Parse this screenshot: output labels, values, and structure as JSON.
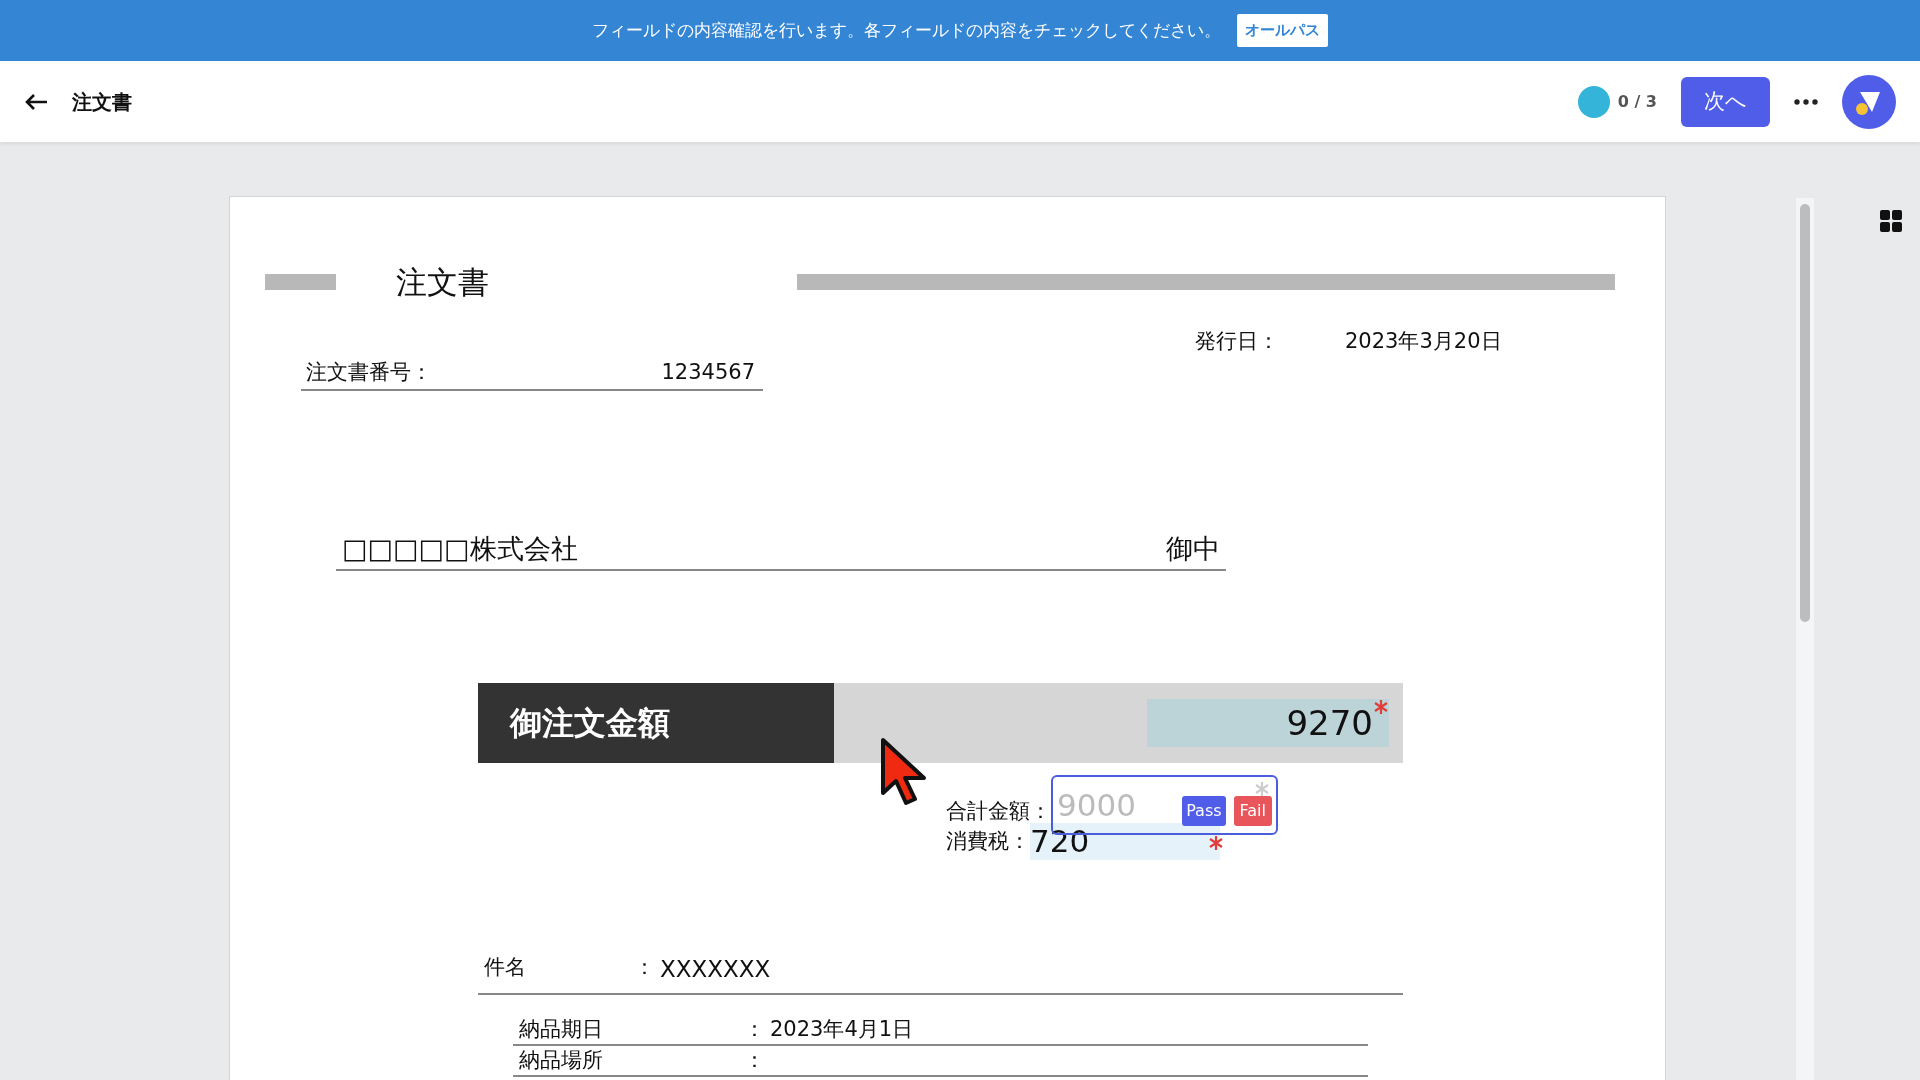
{
  "banner": {
    "message": "フィールドの内容確認を行います。各フィールドの内容をチェックしてください。",
    "button": "オールパス"
  },
  "header": {
    "title": "注文書",
    "progress": "0 / 3",
    "next_button": "次へ"
  },
  "document": {
    "title": "注文書",
    "issue_date_label": "発行日：",
    "issue_date": "2023年3月20日",
    "order_number_label": "注文書番号：",
    "order_number": "1234567",
    "recipient": "□□□□□株式会社",
    "honorific": "御中",
    "amount_label": "御注文金額",
    "amount": "9270",
    "subtotal_label": "合計金額：",
    "subtotal_field": {
      "placeholder": "9000"
    },
    "pass_button": "Pass",
    "fail_button": "Fail",
    "tax_label": "消費税：",
    "tax": "720",
    "fields": [
      {
        "kind": "subject",
        "label": "件名",
        "colon": "：",
        "value": "XXXXXXX"
      },
      {
        "kind": "detail",
        "label": "納品期日",
        "colon": "：",
        "value": "2023年4月1日"
      },
      {
        "kind": "detail",
        "label": "納品場所",
        "colon": "："
      }
    ]
  }
}
